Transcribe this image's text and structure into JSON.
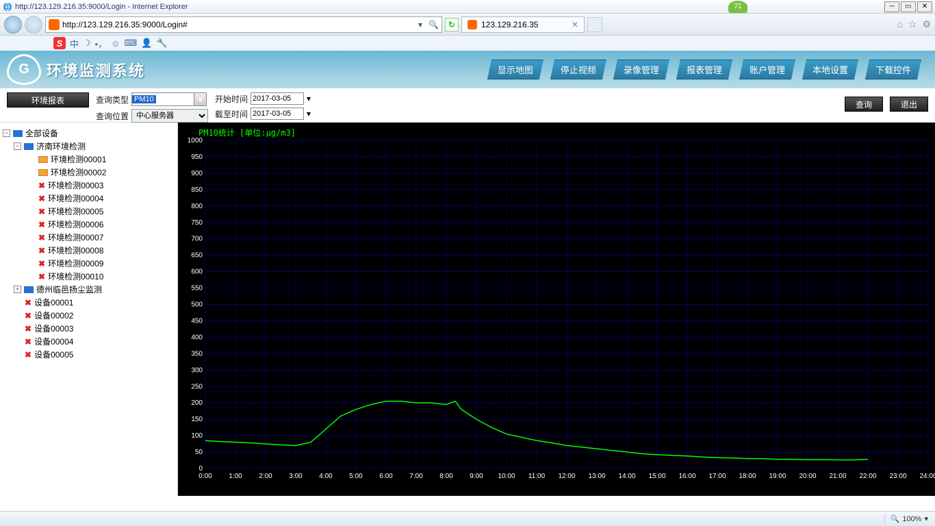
{
  "window": {
    "title": "http://123.129.216.35:9000/Login - Internet Explorer",
    "badge": "71",
    "url": "http://123.129.216.35:9000/Login#",
    "tab_label": "123.129.216.35",
    "zoom": "100%"
  },
  "ime": {
    "chars": "中"
  },
  "app": {
    "title": "环境监测系统",
    "nav": [
      "显示地图",
      "停止视频",
      "录像管理",
      "报表管理",
      "账户管理",
      "本地设置",
      "下载控件"
    ]
  },
  "filter": {
    "report_btn": "环境报表",
    "type_label": "查询类型",
    "type_value": "PM10",
    "loc_label": "查询位置",
    "loc_value": "中心服务器",
    "start_label": "开始时间",
    "start_value": "2017-03-05",
    "end_label": "截至时间",
    "end_value": "2017-03-05",
    "query_btn": "查询",
    "exit_btn": "退出"
  },
  "tree": {
    "root": "全部设备",
    "groups": [
      {
        "name": "济南环境检测",
        "expanded": true,
        "devices": [
          {
            "name": "环境检测00001",
            "on": true
          },
          {
            "name": "环境检测00002",
            "on": true
          },
          {
            "name": "环境检测00003",
            "on": false
          },
          {
            "name": "环境检测00004",
            "on": false
          },
          {
            "name": "环境检测00005",
            "on": false
          },
          {
            "name": "环境检测00006",
            "on": false
          },
          {
            "name": "环境检测00007",
            "on": false
          },
          {
            "name": "环境检测00008",
            "on": false
          },
          {
            "name": "环境检测00009",
            "on": false
          },
          {
            "name": "环境检测00010",
            "on": false
          }
        ]
      },
      {
        "name": "德州临邑扬尘监测",
        "expanded": false,
        "devices": []
      }
    ],
    "loose_devices": [
      {
        "name": "设备00001",
        "on": false
      },
      {
        "name": "设备00002",
        "on": false
      },
      {
        "name": "设备00003",
        "on": false
      },
      {
        "name": "设备00004",
        "on": false
      },
      {
        "name": "设备00005",
        "on": false
      }
    ]
  },
  "chart_data": {
    "type": "line",
    "title": "PM10统计  [单位:μg/m3]",
    "xlabel": "",
    "ylabel": "",
    "ylim": [
      0,
      1000
    ],
    "xlim_hours": [
      0,
      24
    ],
    "x_tick_labels": [
      "0:00",
      "1:00",
      "2:00",
      "3:00",
      "4:00",
      "5:00",
      "6:00",
      "7:00",
      "8:00",
      "9:00",
      "10:00",
      "11:00",
      "12:00",
      "13:00",
      "14:00",
      "15:00",
      "16:00",
      "17:00",
      "18:00",
      "19:00",
      "20:00",
      "21:00",
      "22:00",
      "23:00",
      "24:00"
    ],
    "y_ticks": [
      0,
      50,
      100,
      150,
      200,
      250,
      300,
      350,
      400,
      450,
      500,
      550,
      600,
      650,
      700,
      750,
      800,
      850,
      900,
      950,
      1000
    ],
    "series": [
      {
        "name": "PM10",
        "color": "#00ff00",
        "x": [
          0.0,
          0.5,
          1.0,
          1.5,
          2.0,
          2.5,
          3.0,
          3.5,
          4.0,
          4.5,
          5.0,
          5.5,
          6.0,
          6.5,
          7.0,
          7.5,
          8.0,
          8.3,
          8.5,
          9.0,
          9.5,
          10.0,
          10.5,
          11.0,
          11.5,
          12.0,
          12.5,
          13.0,
          13.5,
          14.0,
          14.5,
          15.0,
          15.5,
          16.0,
          16.5,
          17.0,
          17.5,
          18.0,
          18.5,
          19.0,
          19.5,
          20.0,
          20.5,
          21.0,
          21.5,
          22.0
        ],
        "values": [
          85,
          82,
          80,
          78,
          75,
          72,
          70,
          80,
          120,
          160,
          180,
          195,
          205,
          205,
          200,
          200,
          195,
          205,
          180,
          150,
          125,
          105,
          95,
          85,
          78,
          70,
          65,
          60,
          55,
          50,
          45,
          42,
          40,
          38,
          35,
          33,
          32,
          30,
          30,
          28,
          28,
          27,
          27,
          26,
          26,
          28
        ]
      }
    ]
  }
}
